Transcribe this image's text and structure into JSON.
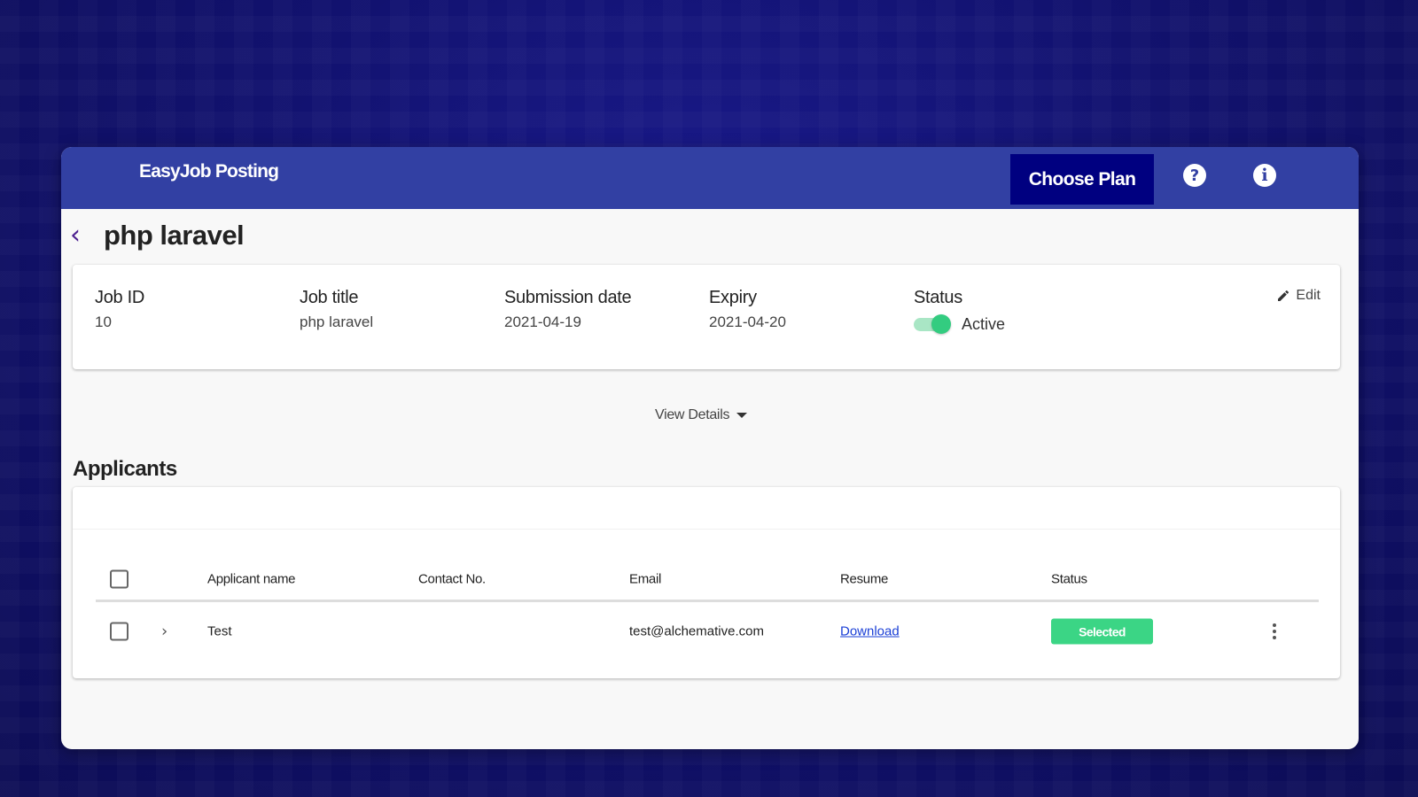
{
  "header": {
    "brand": "EasyJob Posting",
    "choose_plan_label": "Choose Plan",
    "help_icon": "?",
    "info_icon": "i"
  },
  "page": {
    "back_icon": "‹",
    "title": "php laravel"
  },
  "job": {
    "fields": [
      {
        "label": "Job ID",
        "value": "10"
      },
      {
        "label": "Job title",
        "value": "php laravel"
      },
      {
        "label": "Submission date",
        "value": "2021-04-19"
      },
      {
        "label": "Expiry",
        "value": "2021-04-20"
      }
    ],
    "status": {
      "label": "Status",
      "value": "Active",
      "enabled": true
    },
    "edit_label": "Edit"
  },
  "view_details_label": "View Details",
  "applicants": {
    "title": "Applicants",
    "columns": [
      "Applicant name",
      "Contact No.",
      "Email",
      "Resume",
      "Status"
    ],
    "rows": [
      {
        "name": "Test",
        "contact": "",
        "email": "test@alchemative.com",
        "resume": "Download",
        "status": "Selected"
      }
    ]
  },
  "colors": {
    "header": "#3240a3",
    "choose_plan": "#000080",
    "status_selected": "#3bd585",
    "toggle_on": "#33cc80",
    "link": "#1a3fd6"
  }
}
